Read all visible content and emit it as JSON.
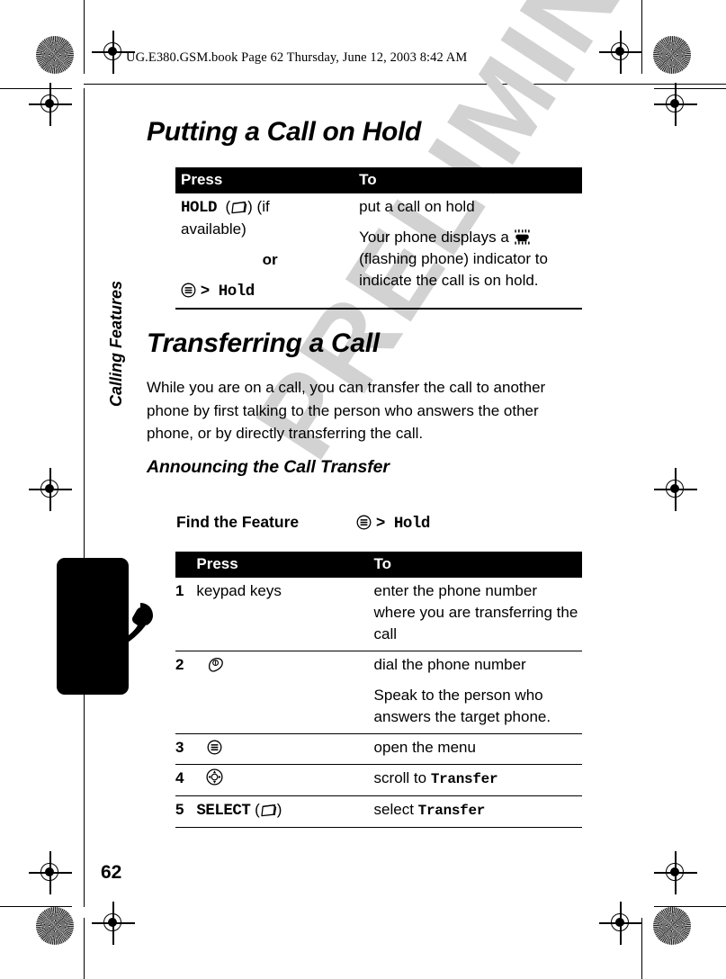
{
  "header": {
    "file_line": "UG.E380.GSM.book  Page 62  Thursday, June 12, 2003  8:42 AM"
  },
  "watermark": {
    "text": "PRELIMINARY"
  },
  "sidebar": {
    "chapter_label": "Calling Features",
    "tab_icon": "phone-handset-icon"
  },
  "page_number": "62",
  "sections": [
    {
      "title": "Putting a Call on Hold",
      "table": {
        "headers": [
          "Press",
          "To"
        ],
        "rows": [
          {
            "press_line1": "HOLD",
            "press_key_icon": "softkey-icon",
            "press_line1_suffix": "(if",
            "press_line2": "available)",
            "press_or": "or",
            "press_menu_icon": "menu-key-icon",
            "press_menu_path": "> Hold",
            "to_line1": "put a call on hold",
            "to_line2_a": "Your phone displays a",
            "to_indicator_icon": "flashing-phone-icon",
            "to_line2_b": "(flashing phone) indicator to indicate the call is on hold."
          }
        ]
      }
    },
    {
      "title": "Transferring a Call",
      "paragraph": "While you are on a call, you can transfer the call to another phone by first talking to the person who answers the other phone, or by directly transferring the call.",
      "subsection": {
        "title": "Announcing the Call Transfer",
        "find_the_feature": {
          "label": "Find the Feature",
          "menu_icon": "menu-key-icon",
          "value": "> Hold"
        },
        "table": {
          "headers": [
            "",
            "Press",
            "To"
          ],
          "rows": [
            {
              "num": "1",
              "press_text": "keypad keys",
              "press_icon": "",
              "to_line1": "enter the phone number where you are transferring the call",
              "to_line2": ""
            },
            {
              "num": "2",
              "press_text": "",
              "press_icon": "send-key-icon",
              "to_line1": "dial the phone number",
              "to_line2": "Speak to the person who answers the target phone."
            },
            {
              "num": "3",
              "press_text": "",
              "press_icon": "menu-key-icon",
              "to_line1": "open the menu",
              "to_line2": ""
            },
            {
              "num": "4",
              "press_text": "",
              "press_icon": "navigation-key-icon",
              "to_line1": "scroll to ",
              "to_mono": "Transfer",
              "to_line2": ""
            },
            {
              "num": "5",
              "press_text": "SELECT",
              "press_icon": "softkey-icon",
              "press_paren": "(",
              "press_paren_close": ")",
              "to_line1": "select ",
              "to_mono": "Transfer",
              "to_line2": ""
            }
          ]
        }
      }
    }
  ],
  "colors": {
    "ink": "#000000",
    "paper": "#ffffff",
    "watermark": "#d2d2d2"
  }
}
